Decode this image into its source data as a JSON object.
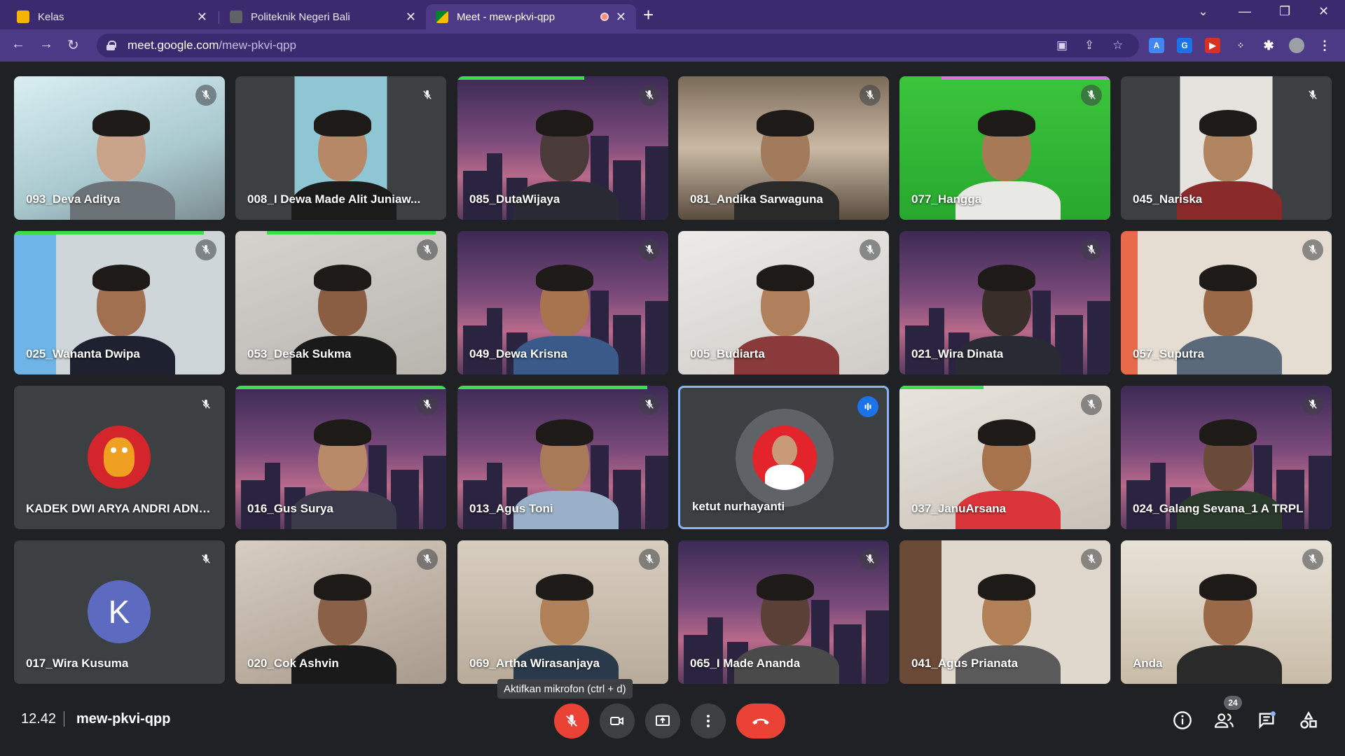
{
  "browser": {
    "tabs": [
      {
        "title": "Kelas"
      },
      {
        "title": "Politeknik Negeri Bali"
      },
      {
        "title": "Meet - mew-pkvi-qpp"
      }
    ],
    "url_host": "meet.google.com",
    "url_path": "/mew-pkvi-qpp"
  },
  "participants": [
    {
      "name": "093_Deva Aditya",
      "muted": true
    },
    {
      "name": "008_I Dewa Made Alit Juniaw...",
      "muted": true
    },
    {
      "name": "085_DutaWijaya",
      "muted": true
    },
    {
      "name": "081_Andika Sarwaguna",
      "muted": true
    },
    {
      "name": "077_Hangga",
      "muted": true
    },
    {
      "name": "045_Nariska",
      "muted": true
    },
    {
      "name": "025_Wananta Dwipa",
      "muted": true
    },
    {
      "name": "053_Desak Sukma",
      "muted": true
    },
    {
      "name": "049_Dewa Krisna",
      "muted": true
    },
    {
      "name": "005_Budiarta",
      "muted": true
    },
    {
      "name": "021_Wira Dinata",
      "muted": true
    },
    {
      "name": "057_Suputra",
      "muted": true
    },
    {
      "name": "KADEK DWI ARYA ANDRI ADNY...",
      "muted": true
    },
    {
      "name": "016_Gus Surya",
      "muted": true
    },
    {
      "name": "013_Agus Toni",
      "muted": true
    },
    {
      "name": "ketut nurhayanti",
      "muted": false,
      "speaking": true
    },
    {
      "name": "037_JanuArsana",
      "muted": true
    },
    {
      "name": "024_Galang Sevana_1 A TRPL",
      "muted": true
    },
    {
      "name": "017_Wira Kusuma",
      "muted": true,
      "avatar_letter": "K"
    },
    {
      "name": "020_Cok Ashvin",
      "muted": true
    },
    {
      "name": "069_Artha Wirasanjaya",
      "muted": true
    },
    {
      "name": "065_I Made Ananda",
      "muted": true
    },
    {
      "name": "041_Agus Prianata",
      "muted": true
    },
    {
      "name": "Anda",
      "muted": true
    }
  ],
  "bottom_bar": {
    "time": "12.42",
    "meeting_code": "mew-pkvi-qpp",
    "tooltip": "Aktifkan mikrofon (ctrl + d)",
    "participant_count": "24"
  },
  "colors": {
    "browser_frame": "#3c2a6e",
    "speaking_border": "#8ab4f8",
    "mic_off_red": "#ea4335",
    "avatar_k": "#5c6bc0"
  }
}
